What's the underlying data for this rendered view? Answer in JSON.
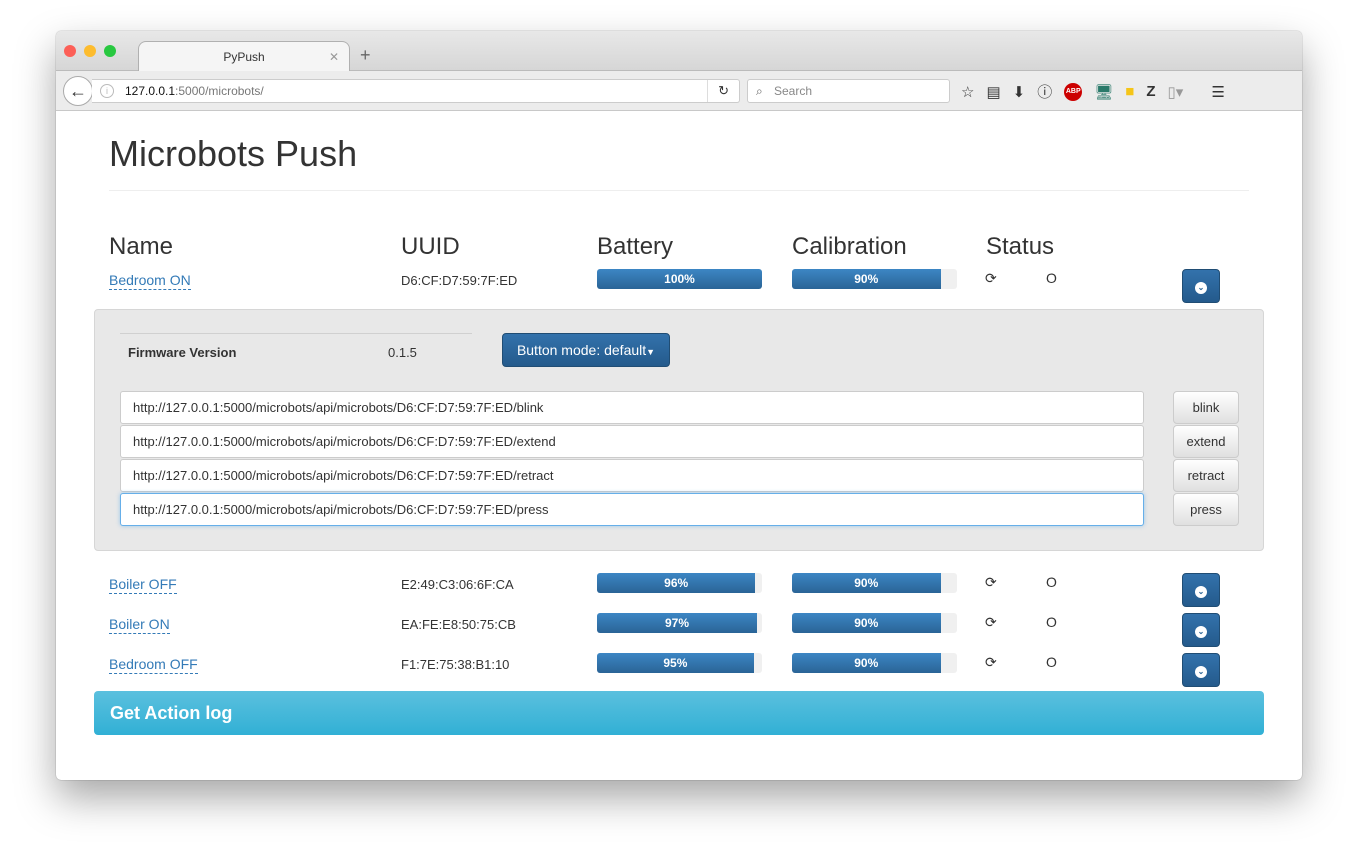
{
  "browser": {
    "tab_title": "PyPush",
    "url_host": "127.0.0.1",
    "url_rest": ":5000/microbots/",
    "search_placeholder": "Search",
    "abp": "ABP"
  },
  "page": {
    "title": "Microbots Push",
    "headers": {
      "name": "Name",
      "uuid": "UUID",
      "battery": "Battery",
      "calibration": "Calibration",
      "status": "Status"
    },
    "devices": [
      {
        "name": "Bedroom ON",
        "uuid": "D6:CF:D7:59:7F:ED",
        "battery": 100,
        "battery_label": "100%",
        "calibration": 90,
        "calibration_label": "90%",
        "status": "O"
      },
      {
        "name": "Boiler OFF",
        "uuid": "E2:49:C3:06:6F:CA",
        "battery": 96,
        "battery_label": "96%",
        "calibration": 90,
        "calibration_label": "90%",
        "status": "O"
      },
      {
        "name": "Boiler ON",
        "uuid": "EA:FE:E8:50:75:CB",
        "battery": 97,
        "battery_label": "97%",
        "calibration": 90,
        "calibration_label": "90%",
        "status": "O"
      },
      {
        "name": "Bedroom OFF",
        "uuid": "F1:7E:75:38:B1:10",
        "battery": 95,
        "battery_label": "95%",
        "calibration": 90,
        "calibration_label": "90%",
        "status": "O"
      }
    ],
    "detail": {
      "firmware_label": "Firmware Version",
      "firmware_value": "0.1.5",
      "mode_button": "Button mode: default",
      "actions": [
        {
          "url": "http://127.0.0.1:5000/microbots/api/microbots/D6:CF:D7:59:7F:ED/blink",
          "label": "blink"
        },
        {
          "url": "http://127.0.0.1:5000/microbots/api/microbots/D6:CF:D7:59:7F:ED/extend",
          "label": "extend"
        },
        {
          "url": "http://127.0.0.1:5000/microbots/api/microbots/D6:CF:D7:59:7F:ED/retract",
          "label": "retract"
        },
        {
          "url": "http://127.0.0.1:5000/microbots/api/microbots/D6:CF:D7:59:7F:ED/press",
          "label": "press"
        }
      ]
    },
    "action_log_button": "Get Action log"
  },
  "colors": {
    "primary": "#337ab7",
    "info": "#5bc0de"
  }
}
